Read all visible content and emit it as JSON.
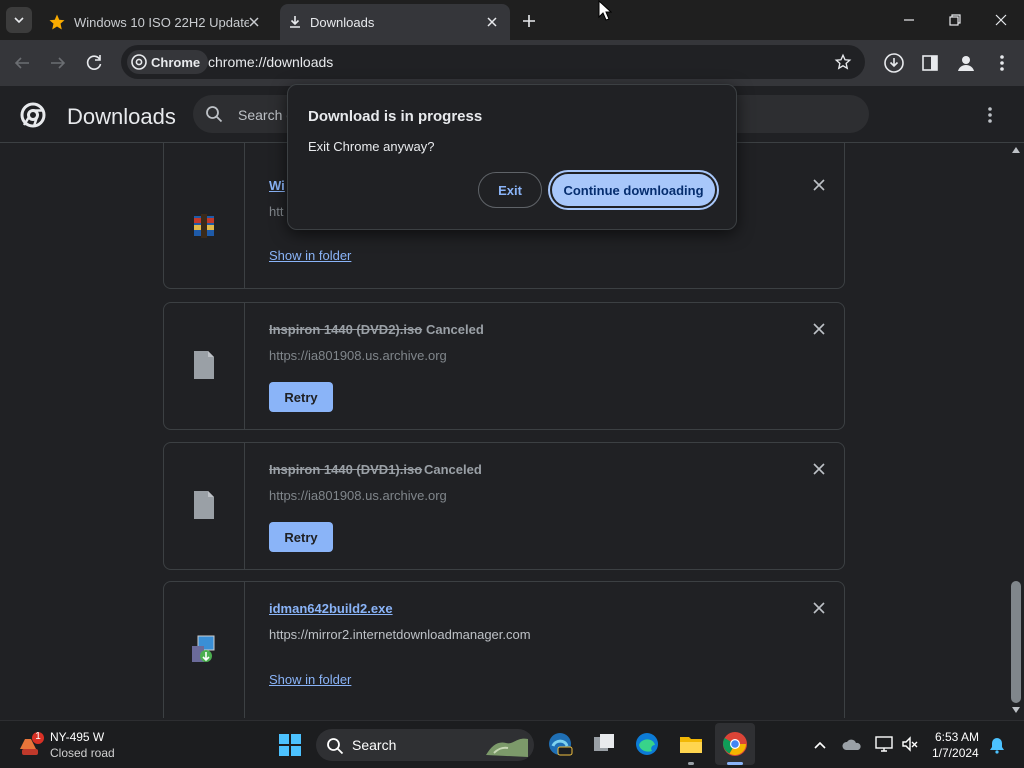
{
  "tabs": [
    {
      "title": "Windows 10 ISO 22H2 Update",
      "icon": "star-icon"
    },
    {
      "title": "Downloads",
      "icon": "download-icon",
      "active": true
    }
  ],
  "toolbar": {
    "site_chip": "Chrome",
    "url": "chrome://downloads"
  },
  "page": {
    "title": "Downloads",
    "search_placeholder": "Search downloads"
  },
  "downloads": [
    {
      "filename": "Wi",
      "source": "htt",
      "action": "Show in folder",
      "status": ""
    },
    {
      "filename": "Inspiron 1440 (DVD2).iso",
      "status": "Canceled",
      "source": "https://ia801908.us.archive.org",
      "action": "Retry"
    },
    {
      "filename": "Inspiron 1440 (DVD1).iso",
      "status": "Canceled",
      "source": "https://ia801908.us.archive.org",
      "action": "Retry"
    },
    {
      "filename": "idman642build2.exe",
      "status": "",
      "source": "https://mirror2.internetdownloadmanager.com",
      "action": "Show in folder"
    }
  ],
  "dialog": {
    "title": "Download is in progress",
    "message": "Exit Chrome anyway?",
    "exit_label": "Exit",
    "continue_label": "Continue downloading"
  },
  "taskbar": {
    "weather_badge": "1",
    "weather_line1": "NY-495 W",
    "weather_line2": "Closed road",
    "search_label": "Search",
    "time": "6:53 AM",
    "date": "1/7/2024"
  },
  "colors": {
    "accent": "#8ab4f8",
    "dialog_primary": "#a8c7fa",
    "background": "#202124"
  }
}
